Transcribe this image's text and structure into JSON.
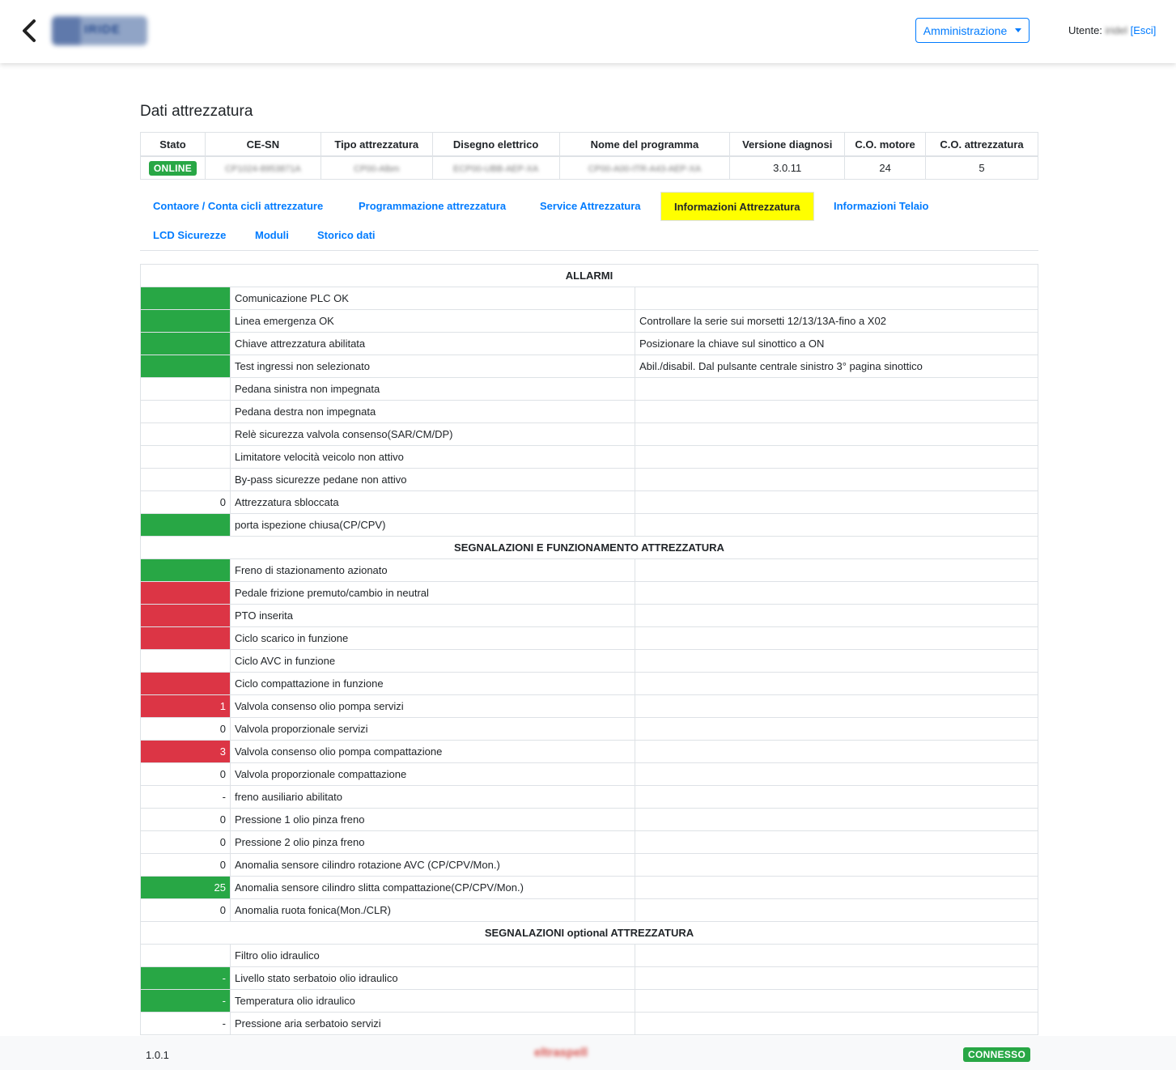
{
  "header": {
    "logo_text": "IRIDE",
    "admin_label": "Amministrazione",
    "user_label": "Utente:",
    "user_name": "iridel",
    "logout_label": "[Esci]"
  },
  "page": {
    "title": "Dati attrezzatura"
  },
  "equipment": {
    "headers": [
      "Stato",
      "CE-SN",
      "Tipo attrezzatura",
      "Disegno elettrico",
      "Nome del programma",
      "Versione diagnosi",
      "C.O. motore",
      "C.O. attrezzatura"
    ],
    "row": {
      "stato": "ONLINE",
      "ce_sn": "CP1024-8953871A",
      "tipo": "CP00-Albm",
      "disegno": "ECP00-UBB-AEP-XA",
      "programma": "CP00-A00-ITR-A43-AEP-XA",
      "versione": "3.0.11",
      "co_motore": "24",
      "co_attrezzatura": "5"
    }
  },
  "tabs": [
    {
      "label": "Contaore / Conta cicli attrezzature"
    },
    {
      "label": "Programmazione attrezzatura"
    },
    {
      "label": "Service Attrezzatura"
    },
    {
      "label": "Informazioni Attrezzatura"
    },
    {
      "label": "Informazioni Telaio"
    },
    {
      "label": "LCD Sicurezze"
    },
    {
      "label": "Moduli"
    },
    {
      "label": "Storico dati"
    }
  ],
  "sections": [
    {
      "title": "ALLARMI",
      "rows": [
        {
          "value": "",
          "status": "green",
          "label": "Comunicazione PLC OK",
          "note": ""
        },
        {
          "value": "",
          "status": "green",
          "label": "Linea emergenza OK",
          "note": "Controllare la serie sui morsetti 12/13/13A-fino a X02"
        },
        {
          "value": "",
          "status": "green",
          "label": "Chiave attrezzatura abilitata",
          "note": "Posizionare la chiave sul sinottico a ON"
        },
        {
          "value": "",
          "status": "green",
          "label": "Test ingressi non selezionato",
          "note": "Abil./disabil. Dal pulsante centrale sinistro 3° pagina sinottico"
        },
        {
          "value": "",
          "status": "none",
          "label": "Pedana sinistra non impegnata",
          "note": ""
        },
        {
          "value": "",
          "status": "none",
          "label": "Pedana destra non impegnata",
          "note": ""
        },
        {
          "value": "",
          "status": "none",
          "label": "Relè sicurezza valvola consenso(SAR/CM/DP)",
          "note": ""
        },
        {
          "value": "",
          "status": "none",
          "label": "Limitatore velocità veicolo non attivo",
          "note": ""
        },
        {
          "value": "",
          "status": "none",
          "label": "By-pass sicurezze pedane non attivo",
          "note": ""
        },
        {
          "value": "0",
          "status": "none",
          "label": "Attrezzatura sbloccata",
          "note": ""
        },
        {
          "value": "",
          "status": "green",
          "label": "porta ispezione chiusa(CP/CPV)",
          "note": ""
        }
      ]
    },
    {
      "title": "SEGNALAZIONI E FUNZIONAMENTO ATTREZZATURA",
      "rows": [
        {
          "value": "",
          "status": "green",
          "label": "Freno di stazionamento azionato",
          "note": ""
        },
        {
          "value": "",
          "status": "red",
          "label": "Pedale frizione premuto/cambio in neutral",
          "note": ""
        },
        {
          "value": "",
          "status": "red",
          "label": "PTO inserita",
          "note": ""
        },
        {
          "value": "",
          "status": "red",
          "label": "Ciclo scarico in funzione",
          "note": ""
        },
        {
          "value": "",
          "status": "none",
          "label": "Ciclo AVC in funzione",
          "note": ""
        },
        {
          "value": "",
          "status": "red",
          "label": "Ciclo compattazione in funzione",
          "note": ""
        },
        {
          "value": "1",
          "status": "red",
          "label": "Valvola consenso olio pompa servizi",
          "note": ""
        },
        {
          "value": "0",
          "status": "none",
          "label": "Valvola proporzionale servizi",
          "note": ""
        },
        {
          "value": "3",
          "status": "red",
          "label": "Valvola consenso olio pompa compattazione",
          "note": ""
        },
        {
          "value": "0",
          "status": "none",
          "label": "Valvola proporzionale compattazione",
          "note": ""
        },
        {
          "value": "-",
          "status": "none",
          "label": "freno ausiliario abilitato",
          "note": ""
        },
        {
          "value": "0",
          "status": "none",
          "label": "Pressione 1 olio pinza freno",
          "note": ""
        },
        {
          "value": "0",
          "status": "none",
          "label": "Pressione 2 olio pinza freno",
          "note": ""
        },
        {
          "value": "0",
          "status": "none",
          "label": "Anomalia sensore cilindro rotazione AVC (CP/CPV/Mon.)",
          "note": ""
        },
        {
          "value": "25",
          "status": "green",
          "label": "Anomalia sensore cilindro slitta compattazione(CP/CPV/Mon.)",
          "note": ""
        },
        {
          "value": "0",
          "status": "none",
          "label": "Anomalia ruota fonica(Mon./CLR)",
          "note": ""
        }
      ]
    },
    {
      "title": "SEGNALAZIONI optional ATTREZZATURA",
      "rows": [
        {
          "value": "",
          "status": "none",
          "label": "Filtro olio idraulico",
          "note": ""
        },
        {
          "value": "-",
          "status": "green",
          "label": "Livello stato serbatoio olio idraulico",
          "note": ""
        },
        {
          "value": "-",
          "status": "green",
          "label": "Temperatura olio idraulico",
          "note": ""
        },
        {
          "value": "-",
          "status": "none",
          "label": "Pressione aria serbatoio servizi",
          "note": ""
        }
      ]
    }
  ],
  "footer": {
    "version": "1.0.1",
    "logo_text": "eltraspell",
    "status": "CONNESSO"
  },
  "colors": {
    "green": "#28a745",
    "red": "#dc3545",
    "accent": "#007bff",
    "active_tab": "#ffff00"
  }
}
